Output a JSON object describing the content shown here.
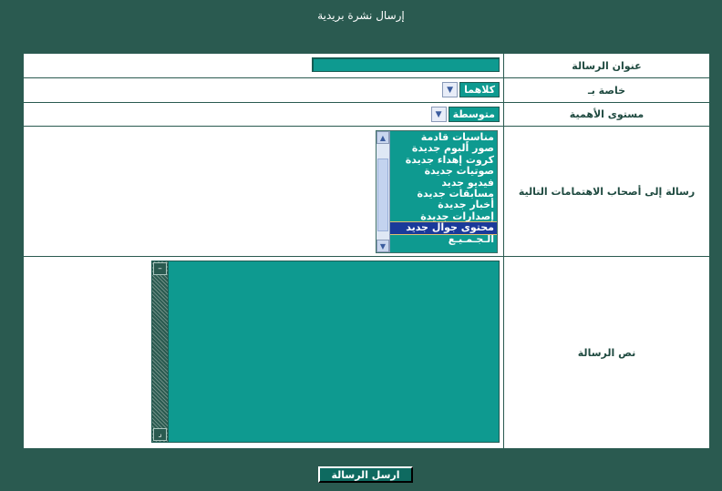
{
  "page": {
    "title": "إرسال نشرة بريدية"
  },
  "form": {
    "subject_label": "عنوان الرسالة",
    "subject_value": "",
    "target_label": "خاصة بـ",
    "target_value": "كلاهما",
    "priority_label": "مستوى الأهمية",
    "priority_value": "متوسطة",
    "interests_label": "رسالة إلى أصحاب الاهتمامات التالية",
    "interests_options": [
      "مناسبات قادمة",
      "صور ألبوم جديدة",
      "كروت إهداء جديدة",
      "صوتيات جديدة",
      "فيديو جديد",
      "مسابقات جديدة",
      "أخبار جديدة",
      "إصدارات جديدة",
      "محتوى جوال جديد",
      "الـجـمـيـع"
    ],
    "interests_selected": "محتوى جوال جديد",
    "body_label": "نص الرسالة",
    "body_value": ""
  },
  "actions": {
    "submit_label": "ارسل الرسالة"
  },
  "colors": {
    "background": "#2a5a50",
    "field": "#0e9a90",
    "selected": "#1a3a9a"
  },
  "icons": {
    "select_arrow": "chevron-down-icon",
    "scroll_up": "chevron-up-icon",
    "scroll_down": "chevron-down-icon"
  }
}
